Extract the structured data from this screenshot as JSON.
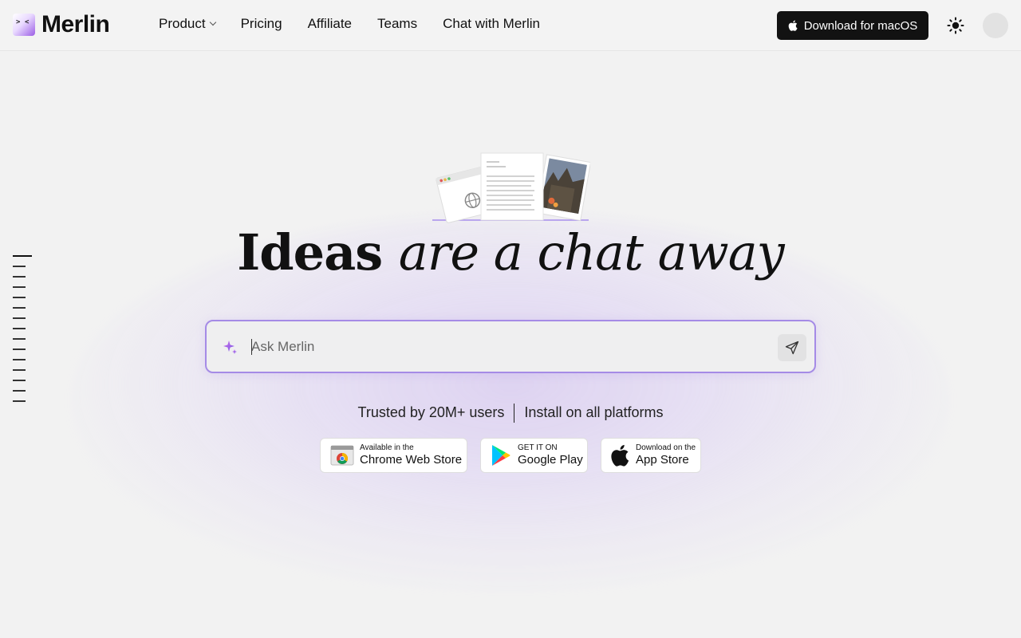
{
  "brand": {
    "name": "Merlin"
  },
  "nav": {
    "items": [
      {
        "label": "Product",
        "has_dropdown": true
      },
      {
        "label": "Pricing"
      },
      {
        "label": "Affiliate"
      },
      {
        "label": "Teams"
      },
      {
        "label": "Chat with Merlin"
      }
    ]
  },
  "header": {
    "download_label": "Download for macOS"
  },
  "hero": {
    "title_plain": "Ideas",
    "title_italic": "are a chat away"
  },
  "search": {
    "placeholder": "Ask Merlin",
    "value": ""
  },
  "trust": {
    "users_text": "Trusted by 20M+ users",
    "platforms_text": "Install on all platforms"
  },
  "stores": [
    {
      "small": "Available in the",
      "big": "Chrome Web Store"
    },
    {
      "small": "GET IT ON",
      "big": "Google Play"
    },
    {
      "small": "Download on the",
      "big": "App Store"
    }
  ],
  "colors": {
    "accent": "#a58be6",
    "button_dark": "#121212",
    "background": "#f2f2f2"
  }
}
